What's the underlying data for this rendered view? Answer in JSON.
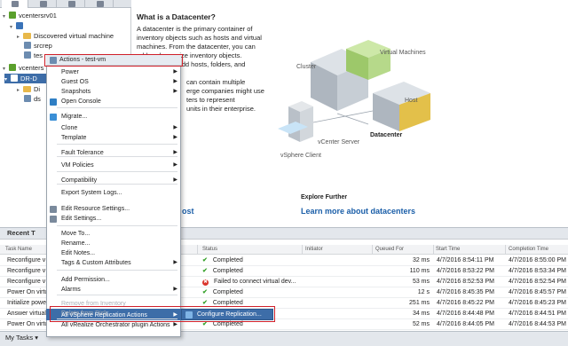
{
  "tree": {
    "items": [
      {
        "label": "vcentersrv01",
        "kind": "vc"
      },
      {
        "label": "",
        "kind": "dc"
      },
      {
        "label": "Discovered virtual machine",
        "kind": "fold"
      },
      {
        "label": "srcrep",
        "kind": "vm"
      },
      {
        "label": "tes",
        "kind": "vm"
      },
      {
        "label": "vcenters",
        "kind": "vc"
      },
      {
        "label": "DR-D",
        "kind": "dc"
      },
      {
        "label": "Di",
        "kind": "fold"
      },
      {
        "label": "ds",
        "kind": "vm"
      }
    ]
  },
  "content": {
    "title": "What is a Datacenter?",
    "para1": "A datacenter is the primary container of inventory objects such as hosts and virtual machines. From the datacenter, you can add and organize inventory objects. Typically, you add hosts, folders, and clusters to a",
    "para2": "can contain multiple\nerge companies might use\nters to represent\nunits in their enterprise.",
    "diagram_labels": {
      "cluster": "Cluster",
      "vms": "Virtual Machines",
      "host": "Host",
      "datacenter": "Datacenter",
      "vcenter": "vCenter Server",
      "client": "vSphere Client"
    },
    "explore_title": "Explore Further",
    "explore_link": "Learn more about datacenters",
    "ghost_link": "ost"
  },
  "context_menu": {
    "header": "Actions - test-vm",
    "items": [
      {
        "label": "Power",
        "submenu": true,
        "disabled": false
      },
      {
        "label": "Guest OS",
        "submenu": true,
        "disabled": false
      },
      {
        "label": "Snapshots",
        "submenu": true,
        "disabled": false
      },
      {
        "label": "Open Console",
        "submenu": false,
        "disabled": false
      },
      {
        "label": "Migrate...",
        "submenu": false,
        "disabled": false
      },
      {
        "label": "Clone",
        "submenu": true,
        "disabled": false
      },
      {
        "label": "Template",
        "submenu": true,
        "disabled": false
      },
      {
        "label": "Fault Tolerance",
        "submenu": true,
        "disabled": false
      },
      {
        "label": "VM Policies",
        "submenu": true,
        "disabled": false
      },
      {
        "label": "Compatibility",
        "submenu": true,
        "disabled": false
      },
      {
        "label": "Export System Logs...",
        "submenu": false,
        "disabled": false
      },
      {
        "label": "Edit Resource Settings...",
        "submenu": false,
        "disabled": false
      },
      {
        "label": "Edit Settings...",
        "submenu": false,
        "disabled": false
      },
      {
        "label": "Move To...",
        "submenu": false,
        "disabled": false
      },
      {
        "label": "Rename...",
        "submenu": false,
        "disabled": false
      },
      {
        "label": "Edit Notes...",
        "submenu": false,
        "disabled": false
      },
      {
        "label": "Tags & Custom Attributes",
        "submenu": true,
        "disabled": false
      },
      {
        "label": "Add Permission...",
        "submenu": false,
        "disabled": false
      },
      {
        "label": "Alarms",
        "submenu": true,
        "disabled": false
      },
      {
        "label": "Remove from Inventory",
        "submenu": false,
        "disabled": true
      },
      {
        "label": "Delete from Disk",
        "submenu": false,
        "disabled": true
      },
      {
        "label": "All vRealize Orchestrator plugin Actions",
        "submenu": true,
        "disabled": false
      },
      {
        "label": "All vSphere Replication Actions",
        "submenu": true,
        "disabled": false
      }
    ],
    "submenu_item": "Configure Replication..."
  },
  "recent_tasks": {
    "title": "Recent T",
    "columns": [
      "Task Name",
      "Status",
      "Initiator",
      "Queued For",
      "Start Time",
      "Completion Time"
    ],
    "rows": [
      {
        "task": "Reconfigure v",
        "status": "Completed",
        "status_type": "ok",
        "queued": "32 ms",
        "start": "4/7/2016 8:54:11 PM",
        "complete": "4/7/2016 8:55:00 PM"
      },
      {
        "task": "Reconfigure v",
        "status": "Completed",
        "status_type": "ok",
        "queued": "110 ms",
        "start": "4/7/2016 8:53:22 PM",
        "complete": "4/7/2016 8:53:34 PM"
      },
      {
        "task": "Reconfigure v",
        "status": "Failed to connect virtual dev...",
        "status_type": "err",
        "queued": "53 ms",
        "start": "4/7/2016 8:52:53 PM",
        "complete": "4/7/2016 8:52:54 PM"
      },
      {
        "task": "Power On virtu",
        "status": "Completed",
        "status_type": "ok",
        "queued": "12 s",
        "start": "4/7/2016 8:45:35 PM",
        "complete": "4/7/2016 8:45:57 PM"
      },
      {
        "task": "Initialize powe",
        "status": "Completed",
        "status_type": "ok",
        "queued": "251 ms",
        "start": "4/7/2016 8:45:22 PM",
        "complete": "4/7/2016 8:45:23 PM"
      },
      {
        "task": "Answer virtual",
        "status": "Completed",
        "status_type": "ok",
        "queued": "34 ms",
        "start": "4/7/2016 8:44:48 PM",
        "complete": "4/7/2016 8:44:51 PM"
      },
      {
        "task": "Power On virtu",
        "status": "Completed",
        "status_type": "ok",
        "queued": "52 ms",
        "start": "4/7/2016 8:44:05 PM",
        "complete": "4/7/2016 8:44:53 PM"
      }
    ]
  },
  "my_tasks": "My Tasks ▾",
  "colors": {
    "accent": "#3d6da8",
    "highlight_box": "#d0202a",
    "ok": "#36a12a",
    "err": "#d9342b"
  }
}
